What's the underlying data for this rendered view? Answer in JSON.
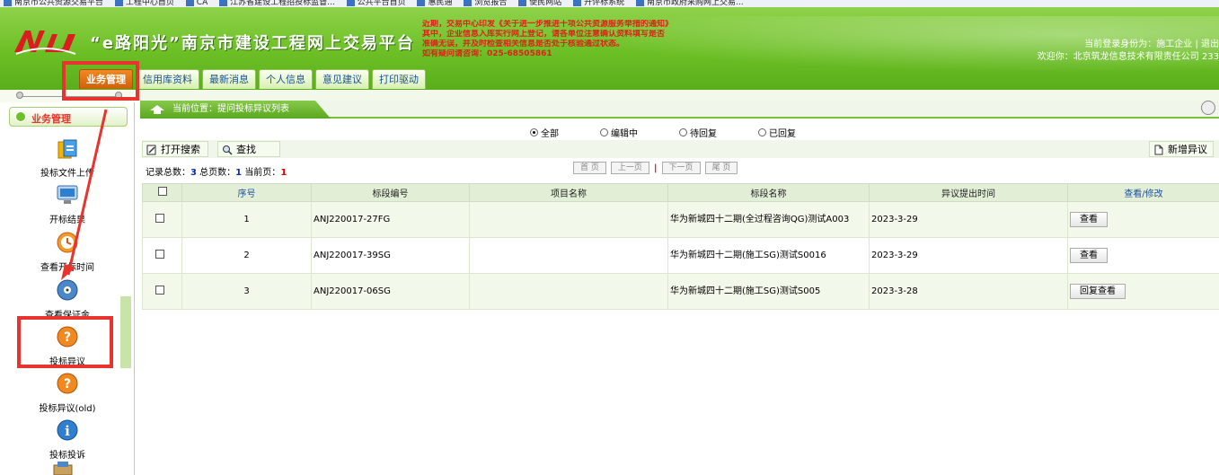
{
  "bookmarks": [
    "南京市公共资源交易平台",
    "工程中心首页",
    "CA",
    "江苏省建设工程招投标监督...",
    "公共平台首页",
    "惠民通",
    "浏览报告",
    "便民网站",
    "开评标系统",
    "南京市政府采购网上交易..."
  ],
  "header": {
    "title": "“e路阳光”南京市建设工程网上交易平台",
    "notice_lines": [
      "近期，交易中心印发《关于进一步推进十项公共资源服务举措的通知》",
      "其中，企业信息入库实行网上登记，请各单位注意确认资料填写是否",
      "准确无误，并及时检查相关信息是否处于核验通过状态。",
      "如有疑问请咨询：025-68505861"
    ],
    "role_text": "当前登录身份为：施工企业 | 退出",
    "welcome_text": "欢迎你：北京筑龙信息技术有限责任公司 233"
  },
  "tabs": [
    "业务管理",
    "信用库资料",
    "最新消息",
    "个人信息",
    "意见建议",
    "打印驱动"
  ],
  "sidebar": {
    "header": "业务管理",
    "items": [
      "投标文件上传",
      "开标结果",
      "查看开标时间",
      "查看保证金",
      "投标异议",
      "投标异议(old)",
      "投标投诉"
    ]
  },
  "breadcrumb": "当前位置：提问投标异议列表",
  "filters": [
    "全部",
    "编辑中",
    "待回复",
    "已回复"
  ],
  "toolbar": {
    "open_search": "打开搜索",
    "search": "查找",
    "add_new": "新增异议"
  },
  "summary": {
    "total_label": "记录总数：",
    "total": "3",
    "pages_label": "总页数：",
    "pages": "1",
    "current_label": "当前页：",
    "current": "1"
  },
  "pager": {
    "first": "首 页",
    "prev": "上一页",
    "sep": "|",
    "next": "下一页",
    "last": "尾 页"
  },
  "table": {
    "headers": [
      "",
      "序号",
      "标段编号",
      "项目名称",
      "标段名称",
      "异议提出时间",
      "查看/修改"
    ],
    "rows": [
      {
        "no": "1",
        "code": "ANJ220017-27FG",
        "project": "",
        "name": "华为新城四十二期(全过程咨询QG)测试A003",
        "time": "2023-3-29",
        "action": "查看"
      },
      {
        "no": "2",
        "code": "ANJ220017-39SG",
        "project": "",
        "name": "华为新城四十二期(施工SG)测试S0016",
        "time": "2023-3-29",
        "action": "查看"
      },
      {
        "no": "3",
        "code": "ANJ220017-06SG",
        "project": "",
        "name": "华为新城四十二期(施工SG)测试S005",
        "time": "2023-3-28",
        "action": "回复查看"
      }
    ]
  },
  "colors": {
    "header_green": "#6cbf25",
    "active_tab": "#f08a20",
    "highlight_red": "#e8332e",
    "link_blue": "#1c4f9a"
  }
}
